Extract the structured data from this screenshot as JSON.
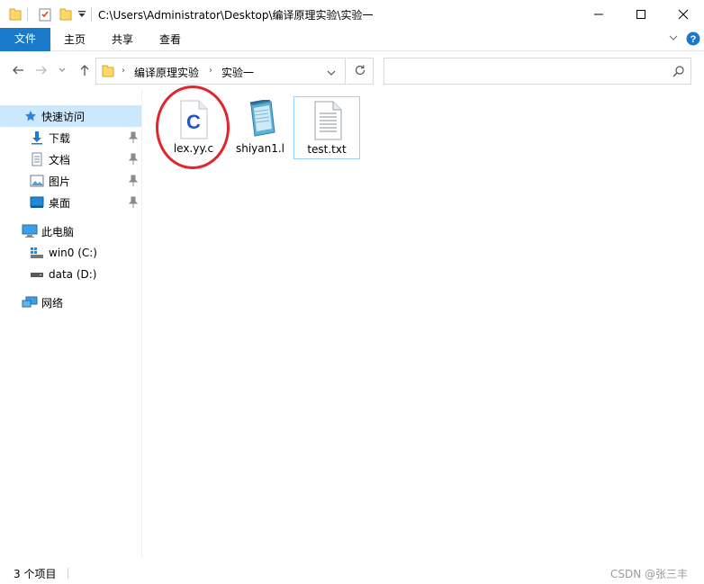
{
  "titlebar": {
    "path": "C:\\Users\\Administrator\\Desktop\\编译原理实验\\实验一",
    "icons": [
      "folder-icon",
      "properties-icon",
      "new-folder-icon",
      "customize-quick-access-icon"
    ],
    "controls": [
      "minimize-icon",
      "maximize-icon",
      "close-icon"
    ]
  },
  "ribbon": {
    "tabs": [
      {
        "label": "文件"
      },
      {
        "label": "主页"
      },
      {
        "label": "共享"
      },
      {
        "label": "查看"
      }
    ],
    "accent": "#1979ca"
  },
  "address": {
    "crumbs": [
      "编译原理实验",
      "实验一"
    ],
    "search_placeholder": ""
  },
  "nav": {
    "items": [
      {
        "label": "快速访问",
        "icon": "star-icon"
      },
      {
        "label": "下载",
        "icon": "download-icon",
        "pinned": true
      },
      {
        "label": "文档",
        "icon": "document-icon",
        "pinned": true
      },
      {
        "label": "图片",
        "icon": "pictures-icon",
        "pinned": true
      },
      {
        "label": "桌面",
        "icon": "desktop-icon",
        "pinned": true
      },
      {
        "label": "此电脑",
        "icon": "computer-icon"
      },
      {
        "label": "win0 (C:)",
        "icon": "windows-drive-icon"
      },
      {
        "label": "data (D:)",
        "icon": "drive-icon"
      },
      {
        "label": "网络",
        "icon": "network-icon"
      }
    ]
  },
  "files": [
    {
      "name": "lex.yy.c",
      "icon": "c-source-file-icon"
    },
    {
      "name": "shiyan1.l",
      "icon": "notepad-file-icon"
    },
    {
      "name": "test.txt",
      "icon": "text-file-icon",
      "selected": true
    }
  ],
  "annotation": {
    "color": "#e2242b"
  },
  "status": {
    "count_text": "3 个项目",
    "watermark": "CSDN @张三丰"
  }
}
